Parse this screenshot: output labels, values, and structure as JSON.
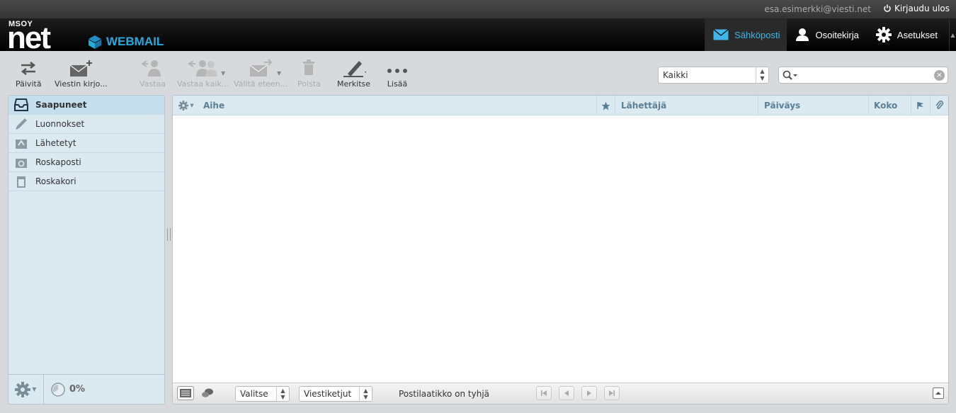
{
  "topbar": {
    "user_email": "esa.esimerkki@viesti.net",
    "logout_label": "Kirjaudu ulos"
  },
  "header": {
    "logo_small": "MSOY",
    "logo_main": "net",
    "product": "WEBMAIL",
    "nav": [
      {
        "label": "Sähköposti",
        "icon": "envelope-icon",
        "active": true
      },
      {
        "label": "Osoitekirja",
        "icon": "person-icon",
        "active": false
      },
      {
        "label": "Asetukset",
        "icon": "gear-icon",
        "active": false
      }
    ]
  },
  "toolbar": {
    "refresh": "Päivitä",
    "compose": "Viestin kirjo...",
    "reply": "Vastaa",
    "reply_all": "Vastaa kaik...",
    "forward": "Välitä eteen...",
    "delete": "Poista",
    "mark": "Merkitse",
    "more": "Lisää",
    "filter_value": "Kaikki",
    "search_value": ""
  },
  "folders": [
    {
      "label": "Saapuneet",
      "icon": "inbox-icon",
      "active": true
    },
    {
      "label": "Luonnokset",
      "icon": "pencil-icon",
      "active": false
    },
    {
      "label": "Lähetetyt",
      "icon": "sent-icon",
      "active": false
    },
    {
      "label": "Roskaposti",
      "icon": "junk-icon",
      "active": false
    },
    {
      "label": "Roskakori",
      "icon": "trash-icon",
      "active": false
    }
  ],
  "quota": "0%",
  "list": {
    "columns": {
      "subject": "Aihe",
      "from": "Lähettäjä",
      "date": "Päiväys",
      "size": "Koko"
    },
    "select_label": "Valitse",
    "threads_label": "Viestiketjut",
    "status": "Postilaatikko on tyhjä"
  },
  "colors": {
    "accent": "#3fb7e8",
    "pane_bg": "#dbe9f1",
    "header_text": "#5a7f94"
  }
}
